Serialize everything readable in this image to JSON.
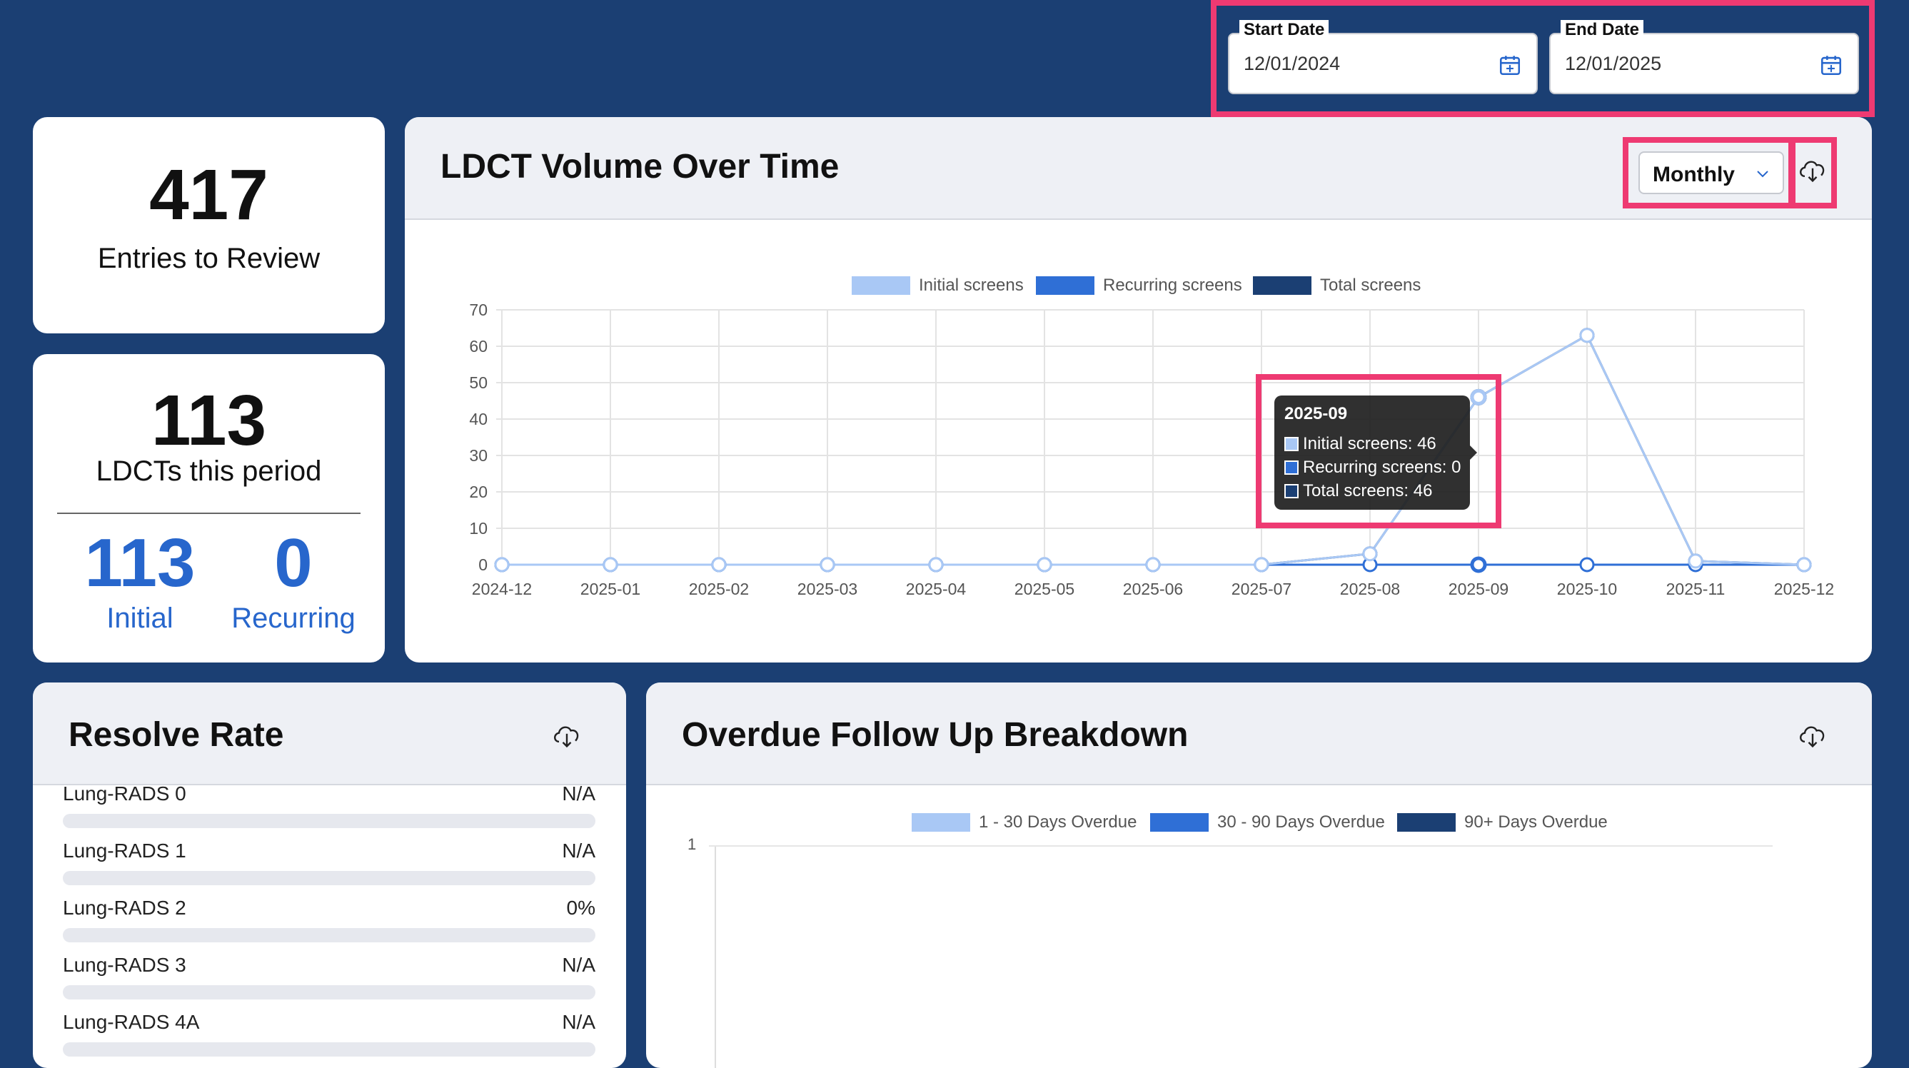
{
  "filters": {
    "start_date": {
      "label": "Start Date",
      "value": "12/01/2024"
    },
    "end_date": {
      "label": "End Date",
      "value": "12/01/2025"
    }
  },
  "stats": {
    "entries_to_review": {
      "value": "417",
      "label": "Entries to Review"
    },
    "ldcts_period": {
      "value": "113",
      "label": "LDCTs this period"
    },
    "initial": {
      "value": "113",
      "label": "Initial"
    },
    "recurring": {
      "value": "0",
      "label": "Recurring"
    }
  },
  "volume_chart": {
    "title": "LDCT Volume Over Time",
    "interval_select": {
      "value": "Monthly"
    },
    "download_icon": "cloud-download-icon",
    "tooltip": {
      "title": "2025-09",
      "rows": [
        "Initial screens: 46",
        "Recurring screens: 0",
        "Total screens: 46"
      ]
    }
  },
  "chart_data": [
    {
      "type": "line",
      "categories": [
        "2024-12",
        "2025-01",
        "2025-02",
        "2025-03",
        "2025-04",
        "2025-05",
        "2025-06",
        "2025-07",
        "2025-08",
        "2025-09",
        "2025-10",
        "2025-11",
        "2025-12"
      ],
      "series": [
        {
          "name": "Initial screens",
          "color": "#a9c8f5",
          "values": [
            0,
            0,
            0,
            0,
            0,
            0,
            0,
            0,
            3,
            46,
            63,
            1,
            0
          ]
        },
        {
          "name": "Recurring screens",
          "color": "#2f6fd6",
          "values": [
            0,
            0,
            0,
            0,
            0,
            0,
            0,
            0,
            0,
            0,
            0,
            0,
            0
          ]
        },
        {
          "name": "Total screens",
          "color": "#1b3f73",
          "values": [
            0,
            0,
            0,
            0,
            0,
            0,
            0,
            0,
            3,
            46,
            63,
            1,
            0
          ]
        }
      ],
      "y_ticks": [
        "0",
        "10",
        "20",
        "30",
        "40",
        "50",
        "60",
        "70"
      ],
      "ylim": [
        0,
        70
      ],
      "grid": true,
      "legend": "top-center"
    },
    {
      "type": "bar",
      "series": [
        {
          "name": "1 - 30 Days Overdue",
          "color": "#a9c8f5",
          "values": []
        },
        {
          "name": "30 - 90 Days Overdue",
          "color": "#2f6fd6",
          "values": []
        },
        {
          "name": "90+ Days Overdue",
          "color": "#1b3f73",
          "values": []
        }
      ],
      "y_ticks": [
        "1"
      ],
      "legend": "top-center"
    }
  ],
  "resolve_rate": {
    "title": "Resolve Rate",
    "rows": [
      {
        "label": "Lung-RADS 0",
        "value": "N/A"
      },
      {
        "label": "Lung-RADS 1",
        "value": "N/A"
      },
      {
        "label": "Lung-RADS 2",
        "value": "0%"
      },
      {
        "label": "Lung-RADS 3",
        "value": "N/A"
      },
      {
        "label": "Lung-RADS 4A",
        "value": "N/A"
      }
    ]
  },
  "overdue": {
    "title": "Overdue Follow Up Breakdown"
  },
  "colors": {
    "background": "#1b3f73",
    "accent": "#2766cc",
    "highlight": "#ee3a72"
  }
}
